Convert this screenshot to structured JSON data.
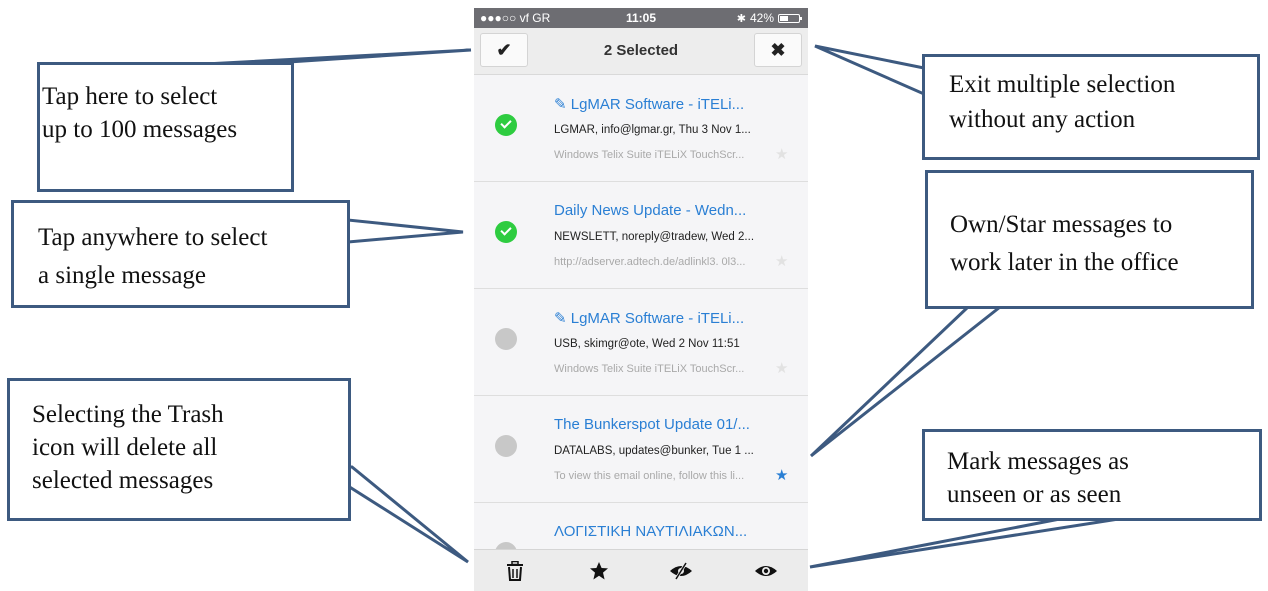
{
  "status_bar": {
    "carrier": "●●●○○ vf GR",
    "time": "11:05",
    "battery": "42%",
    "battery_level": 0.42
  },
  "header": {
    "title": "2 Selected",
    "select_all_icon": "check-icon",
    "exit_icon": "close-icon"
  },
  "messages": [
    {
      "subject": "✎ LgMAR Software - iTELi...",
      "from": "LGMAR, info@lgmar.gr, Thu 3 Nov 1...",
      "preview": "Windows Telix Suite iTELiX TouchScr...",
      "selected": true,
      "starred": false
    },
    {
      "subject": "Daily News Update - Wedn...",
      "from": "NEWSLETT, noreply@tradew, Wed 2...",
      "preview": "http://adserver.adtech.de/adlinkl3. 0l3...",
      "selected": true,
      "starred": false
    },
    {
      "subject": "✎ LgMAR Software - iTELi...",
      "from": "USB, skimgr@ote, Wed 2 Nov 11:51",
      "preview": "Windows Telix Suite iTELiX TouchScr...",
      "selected": false,
      "starred": false
    },
    {
      "subject": "The Bunkerspot Update 01/...",
      "from": "DATALABS, updates@bunker, Tue 1 ...",
      "preview": "To view this email online, follow this li...",
      "selected": false,
      "starred": true
    },
    {
      "subject": "ΛΟΓΙΣΤΙΚΗ ΝΑΥΤΙΛΙΑΚΩΝ...",
      "from": "",
      "preview": "",
      "selected": false,
      "starred": false
    }
  ],
  "bottom_bar": {
    "icons": [
      "trash-icon",
      "star-icon",
      "eye-slash-icon",
      "eye-icon"
    ]
  },
  "callouts": {
    "select_all": [
      "Tap here to select",
      "up to 100 messages"
    ],
    "select_single": [
      "Tap anywhere to select",
      "a single message"
    ],
    "trash": [
      "Selecting the Trash",
      "icon will delete all",
      "selected messages"
    ],
    "exit": [
      "Exit multiple selection",
      "without any action"
    ],
    "star": [
      "Own/Star messages to",
      "work later in the office"
    ],
    "seen": [
      "Mark messages as",
      "unseen or as seen"
    ]
  },
  "colors": {
    "accent": "#2a7fd4",
    "selected": "#2ecc40",
    "callout_border": "#3d5a80"
  }
}
